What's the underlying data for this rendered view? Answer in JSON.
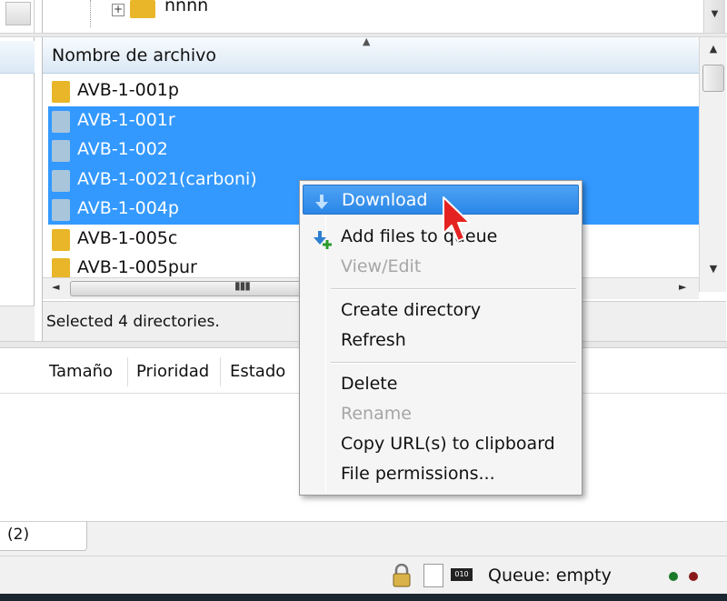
{
  "tree": {
    "node_label": "nnnn"
  },
  "remote": {
    "column_header": "Nombre de archivo",
    "files": [
      {
        "name": "AVB-1-001p",
        "selected": false
      },
      {
        "name": "AVB-1-001r",
        "selected": true
      },
      {
        "name": "AVB-1-002",
        "selected": true
      },
      {
        "name": "AVB-1-0021(carboni)",
        "selected": true
      },
      {
        "name": "AVB-1-004p",
        "selected": true
      },
      {
        "name": "AVB-1-005c",
        "selected": false
      },
      {
        "name": "AVB-1-005pur",
        "selected": false
      }
    ],
    "status": "Selected 4 directories."
  },
  "context_menu": {
    "items": [
      {
        "label": "Download",
        "icon": "download-arrow-icon",
        "highlighted": true,
        "disabled": false
      },
      {
        "label": "Add files to queue",
        "icon": "add-to-queue-icon",
        "highlighted": false,
        "disabled": false
      },
      {
        "label": "View/Edit",
        "highlighted": false,
        "disabled": true
      },
      {
        "label": "Create directory",
        "highlighted": false,
        "disabled": false
      },
      {
        "label": "Refresh",
        "highlighted": false,
        "disabled": false
      },
      {
        "label": "Delete",
        "highlighted": false,
        "disabled": false
      },
      {
        "label": "Rename",
        "highlighted": false,
        "disabled": true
      },
      {
        "label": "Copy URL(s) to clipboard",
        "highlighted": false,
        "disabled": false
      },
      {
        "label": "File permissions...",
        "highlighted": false,
        "disabled": false
      }
    ]
  },
  "queue": {
    "columns": [
      "Tamaño",
      "Prioridad",
      "Estado"
    ]
  },
  "tabs": {
    "active_tab": "(2)"
  },
  "statusbar": {
    "queue_text": "Queue: empty",
    "binary_label": "010"
  },
  "colors": {
    "selection": "#3399ff",
    "menu_highlight": "#3a92ee"
  }
}
